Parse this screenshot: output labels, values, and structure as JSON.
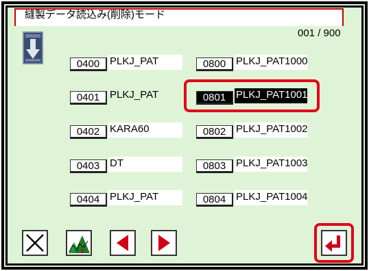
{
  "title": "縫製データ読込み(削除)モード",
  "page_indicator": "001 / 900",
  "files_left": [
    {
      "num": "0400",
      "name": "PLKJ_PAT"
    },
    {
      "num": "0401",
      "name": "PLKJ_PAT"
    },
    {
      "num": "0402",
      "name": "KARA60"
    },
    {
      "num": "0403",
      "name": "DT"
    },
    {
      "num": "0404",
      "name": "PLKJ_PAT"
    }
  ],
  "files_right": [
    {
      "num": "0800",
      "name": "PLKJ_PAT1000"
    },
    {
      "num": "0801",
      "name": "PLKJ_PAT1001",
      "selected": true
    },
    {
      "num": "0802",
      "name": "PLKJ_PAT1002"
    },
    {
      "num": "0803",
      "name": "PLKJ_PAT1003"
    },
    {
      "num": "0804",
      "name": "PLKJ_PAT1004"
    }
  ],
  "icons": {
    "scroll_down": "down-arrow-icon",
    "cancel": "close-icon",
    "preview": "pattern-preview-icon",
    "prev": "left-arrow-icon",
    "next": "right-arrow-icon",
    "enter": "enter-icon"
  },
  "colors": {
    "background": "#dff4d6",
    "highlight": "#e2001a",
    "selected": "#000000",
    "arrow": "#d00018"
  }
}
